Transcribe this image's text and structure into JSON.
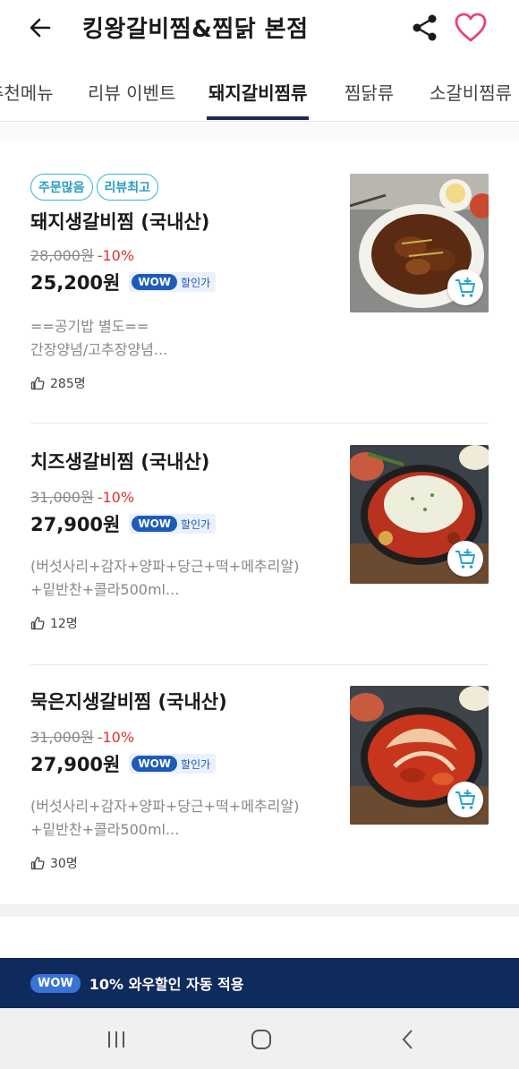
{
  "header": {
    "title": "킹왕갈비찜&찜닭 본점"
  },
  "tabs": [
    {
      "label": "추천메뉴"
    },
    {
      "label": "리뷰 이벤트"
    },
    {
      "label": "돼지갈비찜류"
    },
    {
      "label": "찜닭류"
    },
    {
      "label": "소갈비찜류"
    }
  ],
  "items": [
    {
      "badges": [
        "주문많음",
        "리뷰최고"
      ],
      "name": "돼지생갈비찜 (국내산)",
      "original_price": "28,000원",
      "discount": "-10%",
      "price": "25,200원",
      "wow_label": "WOW",
      "wow_text": "할인가",
      "desc_line1": "==공기밥 별도==",
      "desc_line2": "간장양념/고추장양념...",
      "likes": "285명"
    },
    {
      "name": "치즈생갈비찜 (국내산)",
      "original_price": "31,000원",
      "discount": "-10%",
      "price": "27,900원",
      "wow_label": "WOW",
      "wow_text": "할인가",
      "desc_line1": "(버섯사리+감자+양파+당근+떡+메추리알)",
      "desc_line2": "+밑반찬+콜라500ml...",
      "likes": "12명"
    },
    {
      "name": "묵은지생갈비찜 (국내산)",
      "original_price": "31,000원",
      "discount": "-10%",
      "price": "27,900원",
      "wow_label": "WOW",
      "wow_text": "할인가",
      "desc_line1": "(버섯사리+감자+양파+당근+떡+메추리알)",
      "desc_line2": "+밑반찬+콜라500ml...",
      "likes": "30명"
    }
  ],
  "banner": {
    "wow_label": "WOW",
    "text": "10% 와우할인 자동 적용"
  },
  "colors": {
    "accent_blue": "#1e5bb8",
    "banner_bg": "#0f2a5c",
    "discount_red": "#e0332f",
    "badge_cyan": "#36b3d6",
    "heart_pink": "#e8437a"
  },
  "icons": {
    "back": "arrow-left-icon",
    "share": "share-icon",
    "favorite": "heart-icon",
    "cart": "cart-add-icon",
    "like": "thumbs-up-icon"
  }
}
